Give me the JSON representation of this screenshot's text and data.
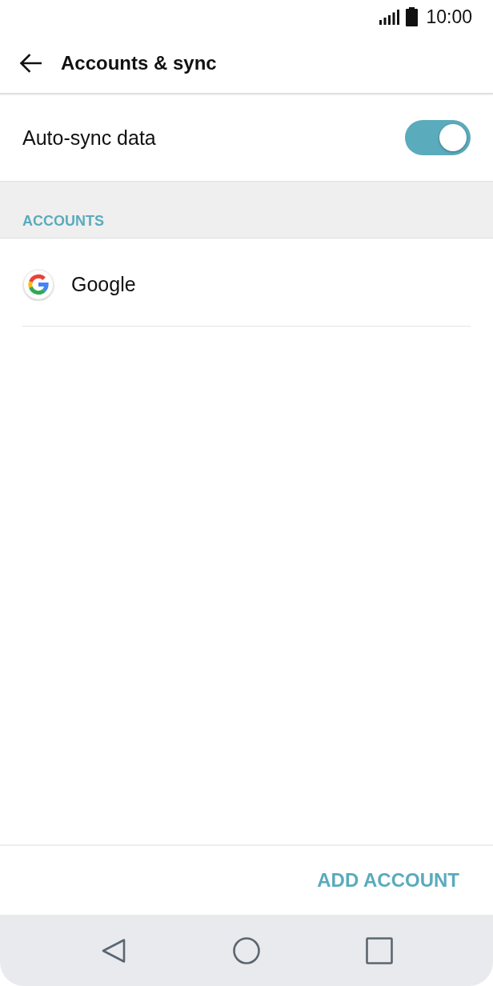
{
  "status_bar": {
    "time": "10:00"
  },
  "app_bar": {
    "title": "Accounts & sync"
  },
  "settings": [
    {
      "label": "Auto-sync data",
      "on": true
    }
  ],
  "section": {
    "header": "ACCOUNTS"
  },
  "accounts": [
    {
      "name": "Google"
    }
  ],
  "footer": {
    "button": "ADD ACCOUNT"
  }
}
